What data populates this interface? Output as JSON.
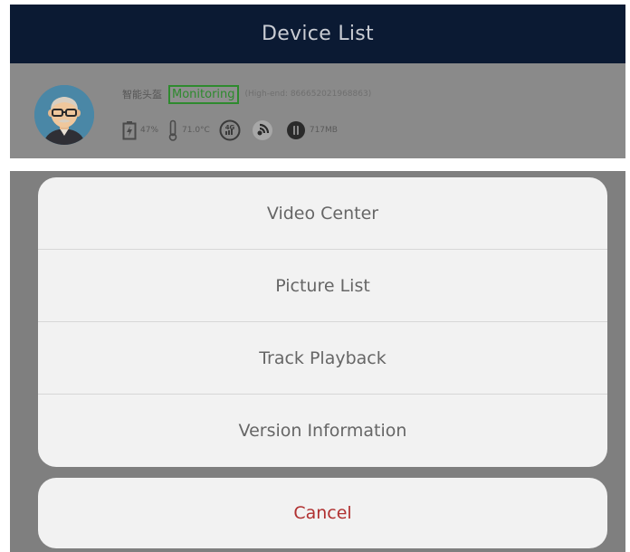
{
  "header": {
    "title": "Device List"
  },
  "device": {
    "name": "智能头盔",
    "status": "Monitoring",
    "id_text": "(High-end: 866652021968863)",
    "battery": "47%",
    "temperature": "71.0°C",
    "memory": "717MB"
  },
  "action_sheet": {
    "items": [
      {
        "label": "Video Center"
      },
      {
        "label": "Picture List"
      },
      {
        "label": "Track Playback"
      },
      {
        "label": "Version Information"
      }
    ],
    "cancel_label": "Cancel"
  },
  "icons": {
    "battery": "battery-charging-icon",
    "temperature": "thermometer-icon",
    "network": "4g-signal-icon",
    "signal": "signal-icon",
    "memory": "memory-icon"
  },
  "colors": {
    "header_bg": "#0b1a33",
    "status_green": "#2e8a2e",
    "cancel_red": "#b03030",
    "overlay": "#7f7f7f",
    "sheet_bg": "#f2f2f2"
  }
}
